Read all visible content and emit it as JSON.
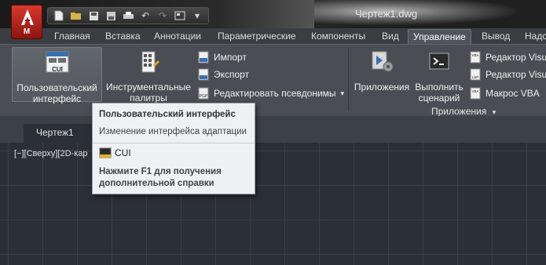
{
  "app": {
    "menu_letter": "M",
    "window_title": "Чертеж1.dwg"
  },
  "quick_access": {
    "icons": [
      "new-icon",
      "open-icon",
      "save-icon",
      "save-as-icon",
      "print-icon",
      "undo-icon",
      "redo-icon",
      "workspace-icon",
      "dropdown-icon"
    ]
  },
  "ribbon_tabs": [
    {
      "label": "Главная"
    },
    {
      "label": "Вставка"
    },
    {
      "label": "Аннотации"
    },
    {
      "label": "Параметрические"
    },
    {
      "label": "Компоненты"
    },
    {
      "label": "Вид"
    },
    {
      "label": "Управление",
      "active": true
    },
    {
      "label": "Вывод"
    },
    {
      "label": "Надс"
    }
  ],
  "ribbon": {
    "cui_button": {
      "icon_text": "CUI",
      "line1": "Пользовательский",
      "line2": "интерфейс"
    },
    "tool_palettes_button": {
      "line1": "Инструментальные",
      "line2": "палитры"
    },
    "import_label": "Импорт",
    "export_label": "Экспорт",
    "edit_aliases_label": "Редактировать псевдонимы",
    "apps_button": {
      "label": "Приложения"
    },
    "run_script_button": {
      "line1": "Выполнить",
      "line2": "сценарий"
    },
    "vba_editor_label": "Редактор Visu",
    "vbs_editor_label": "Редактор Visu",
    "vba_macro_label": "Макрос VBA",
    "apps_panel_title": "Приложения"
  },
  "file_tab": {
    "label": "Чертеж1"
  },
  "viewport_label": "[−][Сверху][2D-кар",
  "tooltip": {
    "title": "Пользовательский  интерфейс",
    "description": "Изменение интерфейса адаптации",
    "command": "CUI",
    "help_line1": "Нажмите F1 для получения",
    "help_line2": "дополнительной справки"
  },
  "colors": {
    "app_button": "#c42a22",
    "ribbon_bg": "#4a4d53",
    "canvas_bg": "#2b2f38",
    "tooltip_bg": "#eef0f3"
  }
}
